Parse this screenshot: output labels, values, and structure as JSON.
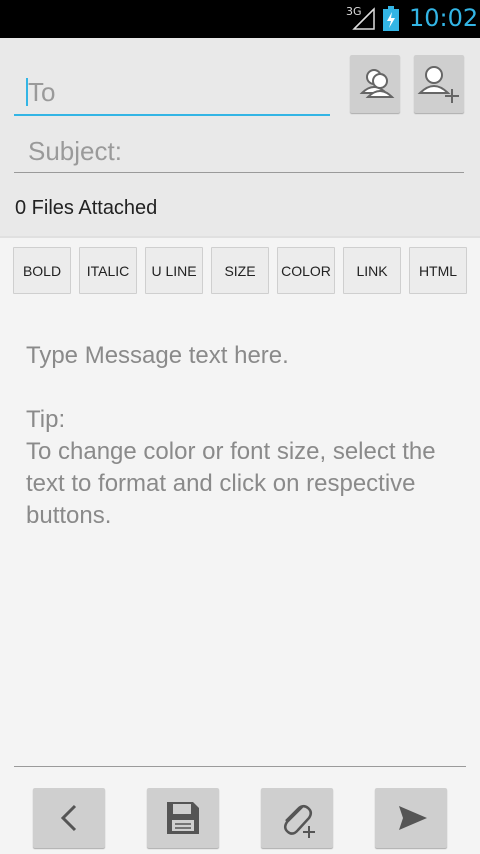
{
  "status_bar": {
    "network": "3G",
    "time": "10:02",
    "icons": [
      "signal-icon",
      "battery-charging-icon"
    ]
  },
  "compose": {
    "to_placeholder": "To",
    "subject_placeholder": "Subject:",
    "attachments_label": "0 Files Attached",
    "header_icons": [
      "contacts-group-icon",
      "add-contact-icon"
    ]
  },
  "format_toolbar": {
    "buttons": [
      "BOLD",
      "ITALIC",
      "U LINE",
      "SIZE",
      "COLOR",
      "LINK",
      "HTML"
    ]
  },
  "message": {
    "placeholder": "Type Message text here.\n\nTip:\nTo change color or font size, select the text to format and click on respective buttons."
  },
  "bottom_bar": {
    "icons": [
      "back-icon",
      "save-icon",
      "attach-icon",
      "send-icon"
    ]
  },
  "colors": {
    "accent": "#33b5e5",
    "button_bg": "#cfcfcf",
    "background": "#f4f4f4"
  }
}
